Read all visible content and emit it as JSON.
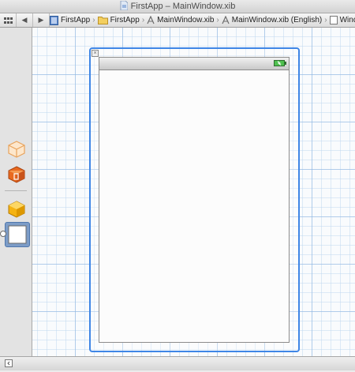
{
  "window_title": "FirstApp – MainWindow.xib",
  "jump_bar": {
    "crumbs": [
      {
        "label": "FirstApp",
        "icon": "project-icon"
      },
      {
        "label": "FirstApp",
        "icon": "folder-icon"
      },
      {
        "label": "MainWindow.xib",
        "icon": "xib-file-icon"
      },
      {
        "label": "MainWindow.xib (English)",
        "icon": "xib-file-icon"
      },
      {
        "label": "Window",
        "icon": "window-icon"
      }
    ]
  },
  "sidebar": {
    "objects": [
      {
        "name": "File's Owner",
        "icon": "files-owner-cube-icon"
      },
      {
        "name": "First Responder",
        "icon": "first-responder-cube-icon"
      },
      {
        "name": "App Delegate",
        "icon": "object-cube-icon"
      },
      {
        "name": "Window",
        "icon": "window-object-icon",
        "selected": true
      }
    ]
  },
  "colors": {
    "selection": "#3f86e6",
    "grid": "#8cb4e1"
  }
}
